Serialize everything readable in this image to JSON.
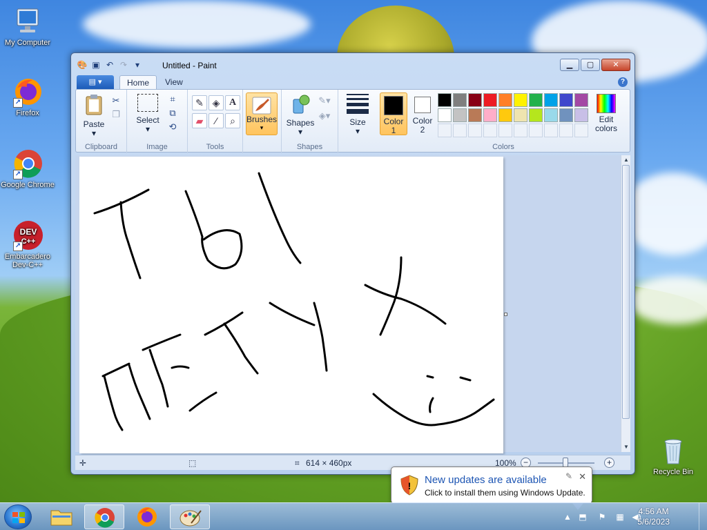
{
  "desktop": {
    "icons": [
      {
        "label": "My Computer"
      },
      {
        "label": "Firefox"
      },
      {
        "label": "Google Chrome"
      },
      {
        "label": "Embarcadero Dev-C++"
      },
      {
        "label": "Recycle Bin"
      }
    ],
    "devcpp_logo_text": "DEV C++"
  },
  "window": {
    "title": "Untitled - Paint",
    "file_button": "▤ ▾",
    "tabs": [
      {
        "label": "Home"
      },
      {
        "label": "View"
      }
    ],
    "help_label": "?"
  },
  "ribbon": {
    "clipboard": {
      "paste": "Paste",
      "group": "Clipboard"
    },
    "image": {
      "select": "Select",
      "group": "Image"
    },
    "tools": {
      "group": "Tools"
    },
    "brushes": "Brushes",
    "shapes": {
      "shapes": "Shapes",
      "group": "Shapes"
    },
    "size": "Size",
    "colors": {
      "color1": "Color",
      "color1_num": "1",
      "color2": "Color",
      "color2_num": "2",
      "edit1": "Edit",
      "edit2": "colors",
      "group": "Colors",
      "color1_value": "#000000",
      "color2_value": "#ffffff",
      "palette": [
        "#000000",
        "#7f7f7f",
        "#880015",
        "#ed1c24",
        "#ff7f27",
        "#fff200",
        "#22b14c",
        "#00a2e8",
        "#3f48cc",
        "#a349a4",
        "#ffffff",
        "#c3c3c3",
        "#b97a57",
        "#ffaec9",
        "#ffc90e",
        "#efe4b0",
        "#b5e61d",
        "#99d9ea",
        "#7092be",
        "#c8bfe7"
      ]
    }
  },
  "status": {
    "canvas_size": "614 × 460px",
    "zoom": "100%"
  },
  "notification": {
    "title": "New updates are available",
    "body": "Click to install them using Windows Update."
  },
  "taskbar": {
    "time": "4:56 AM",
    "date": "5/6/2023"
  }
}
